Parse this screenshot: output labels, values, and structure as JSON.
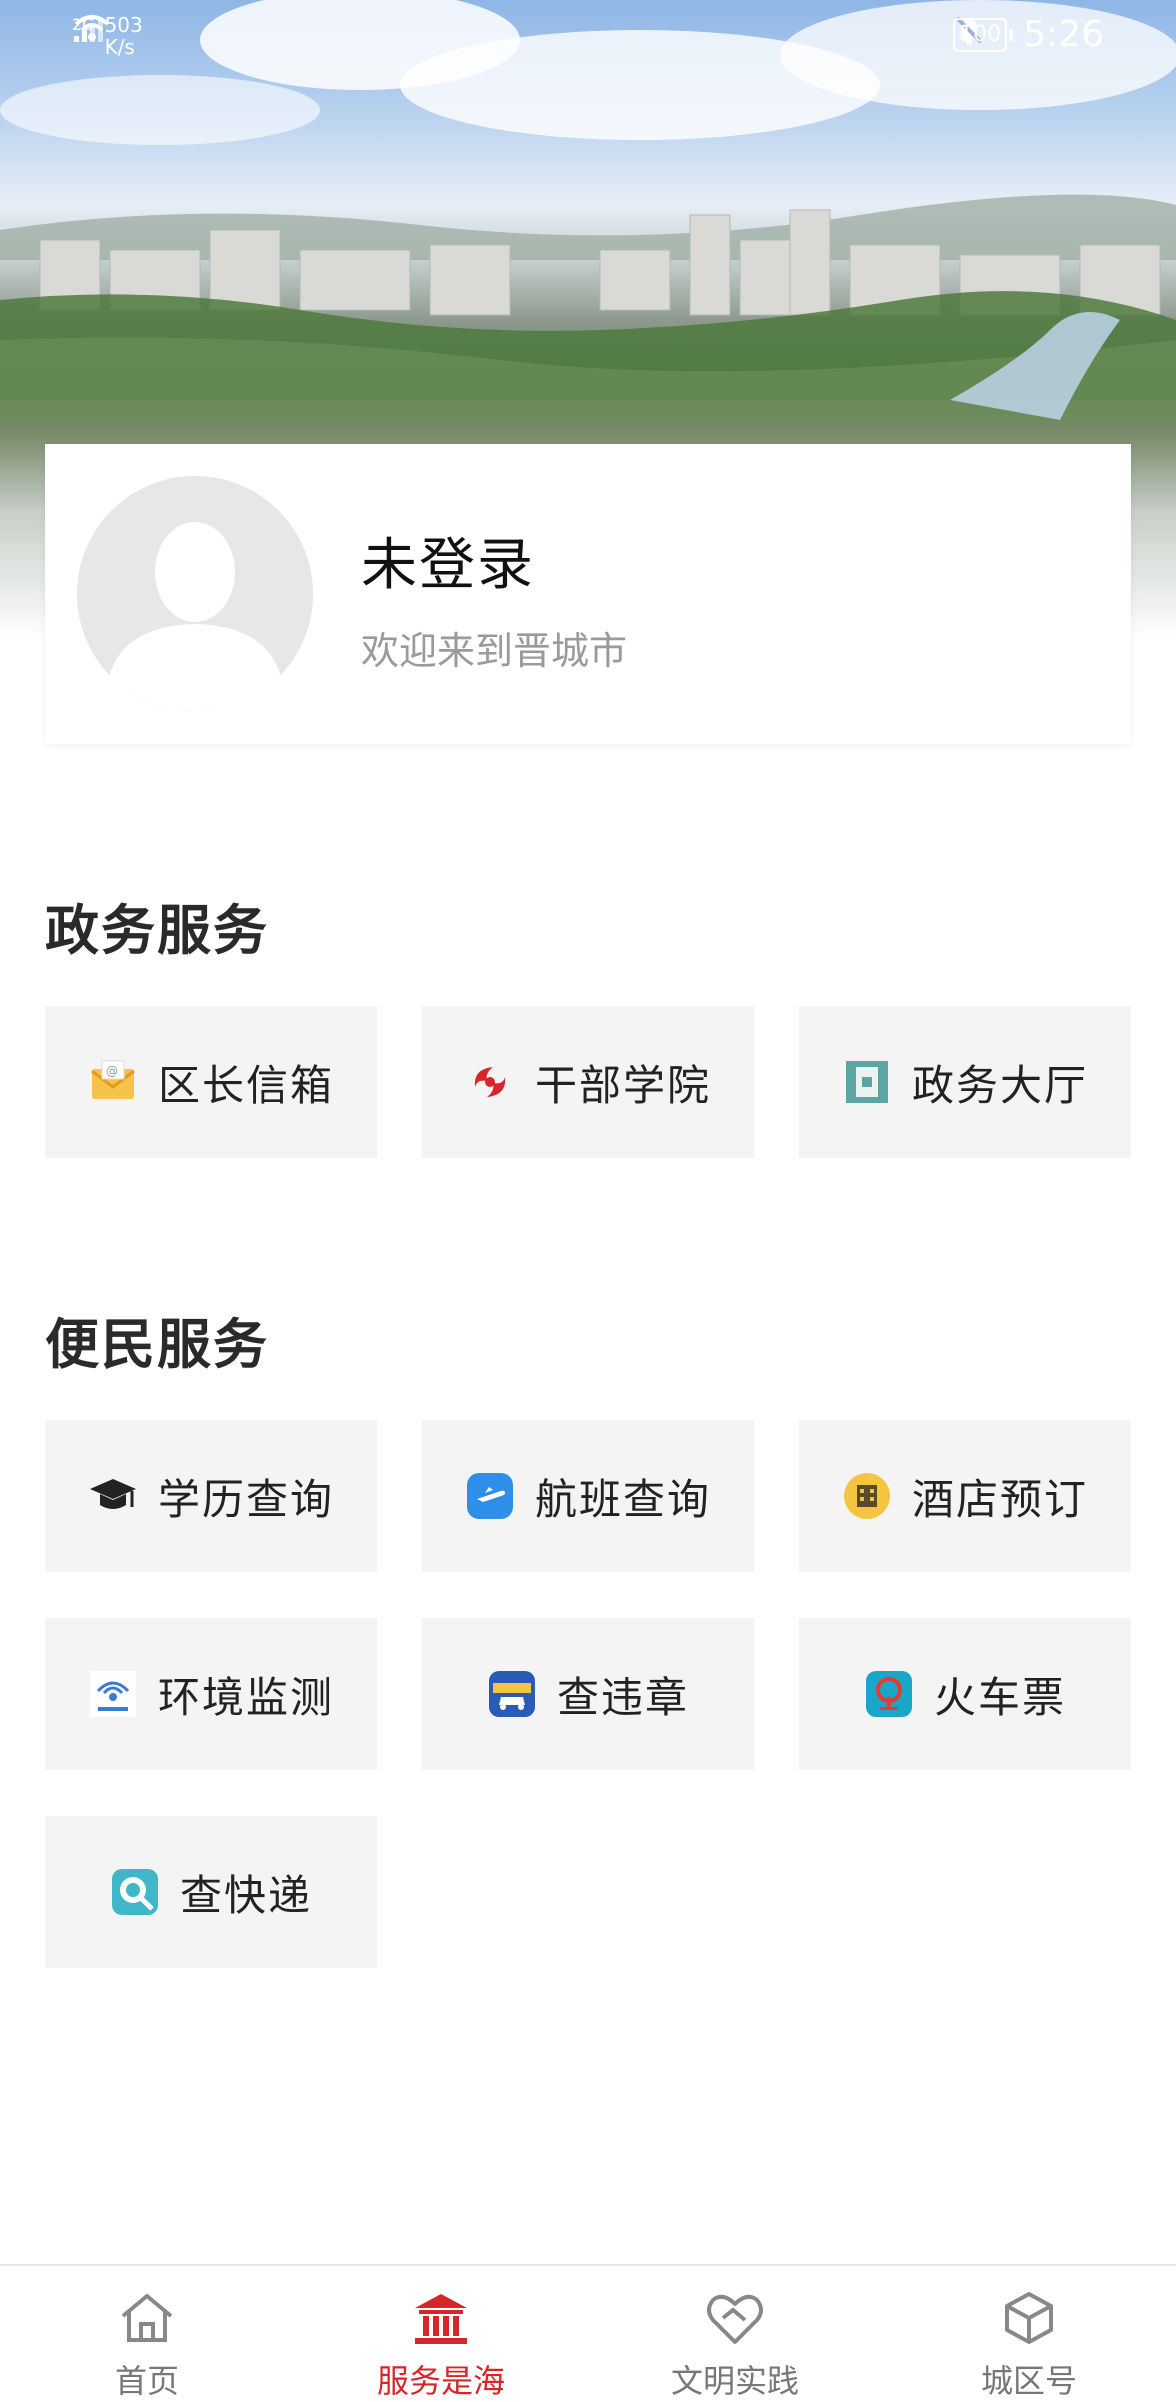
{
  "status_bar": {
    "network": "2G",
    "speed_value": "503",
    "speed_unit": "K/s",
    "battery": "100",
    "time": "5:26"
  },
  "profile": {
    "title": "未登录",
    "subtitle": "欢迎来到晋城市"
  },
  "gov_services": {
    "title": "政务服务",
    "items": [
      {
        "label": "区长信箱",
        "icon": "mail-icon"
      },
      {
        "label": "干部学院",
        "icon": "academy-logo-icon"
      },
      {
        "label": "政务大厅",
        "icon": "hall-icon"
      }
    ]
  },
  "public_services": {
    "title": "便民服务",
    "items": [
      {
        "label": "学历查询",
        "icon": "graduation-cap-icon"
      },
      {
        "label": "航班查询",
        "icon": "airplane-icon"
      },
      {
        "label": "酒店预订",
        "icon": "hotel-icon"
      },
      {
        "label": "环境监测",
        "icon": "environment-monitor-icon"
      },
      {
        "label": "查违章",
        "icon": "traffic-violation-icon"
      },
      {
        "label": "火车票",
        "icon": "train-ticket-icon"
      },
      {
        "label": "查快递",
        "icon": "express-search-icon"
      }
    ]
  },
  "bottom_nav": {
    "items": [
      {
        "label": "首页",
        "icon": "home-icon"
      },
      {
        "label": "服务是海",
        "icon": "service-hall-icon",
        "active": true
      },
      {
        "label": "文明实践",
        "icon": "handshake-heart-icon"
      },
      {
        "label": "城区号",
        "icon": "cube-icon"
      }
    ]
  },
  "colors": {
    "accent": "#d7262a",
    "tile_bg": "#f4f4f4",
    "muted_text": "#9a9a9a"
  }
}
